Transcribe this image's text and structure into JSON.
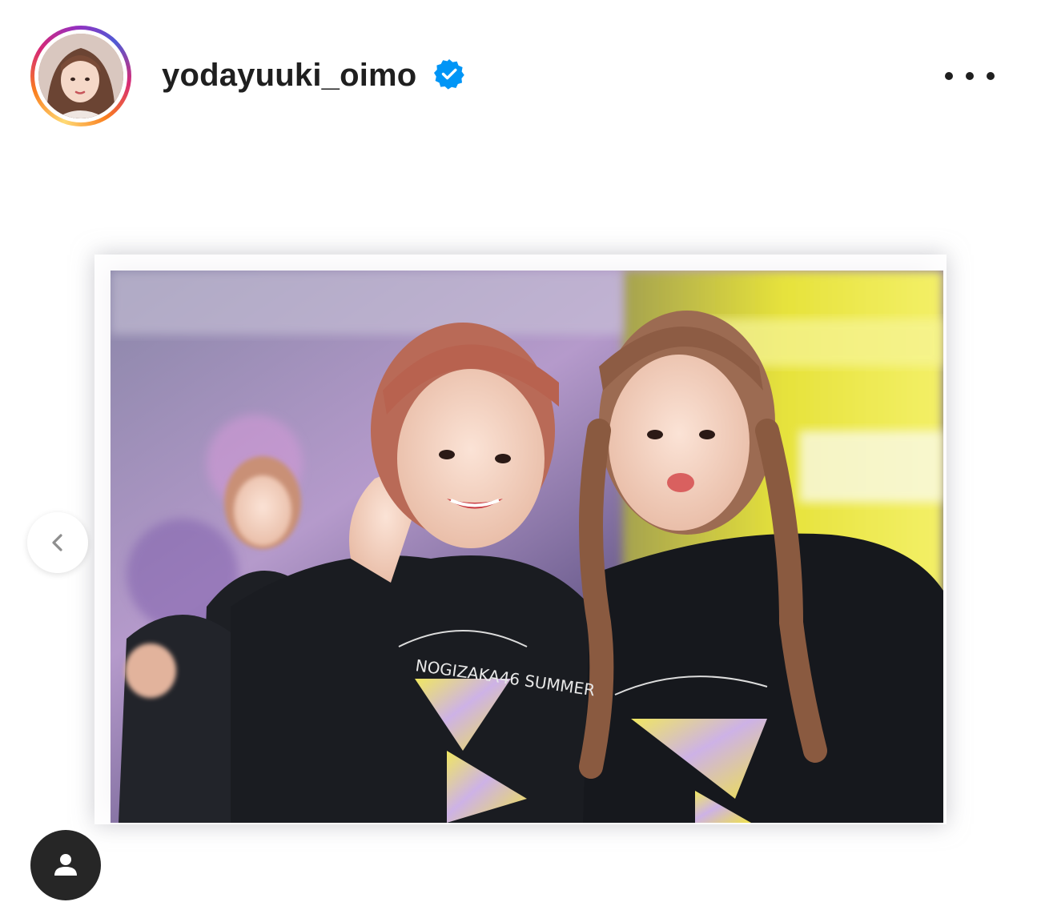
{
  "post": {
    "username": "yodayuuki_oimo",
    "verified": true,
    "avatar_icon": "profile-photo",
    "more_icon": "more-horizontal-icon"
  },
  "media": {
    "photo_icon": "post-photo",
    "prev_icon": "chevron-left-icon",
    "tags_icon": "user-tag-icon",
    "tshirt_text": "NOGIZAKA46 SUMMER"
  },
  "colors": {
    "verified_blue": "#0095f6",
    "text_primary": "#262626"
  }
}
